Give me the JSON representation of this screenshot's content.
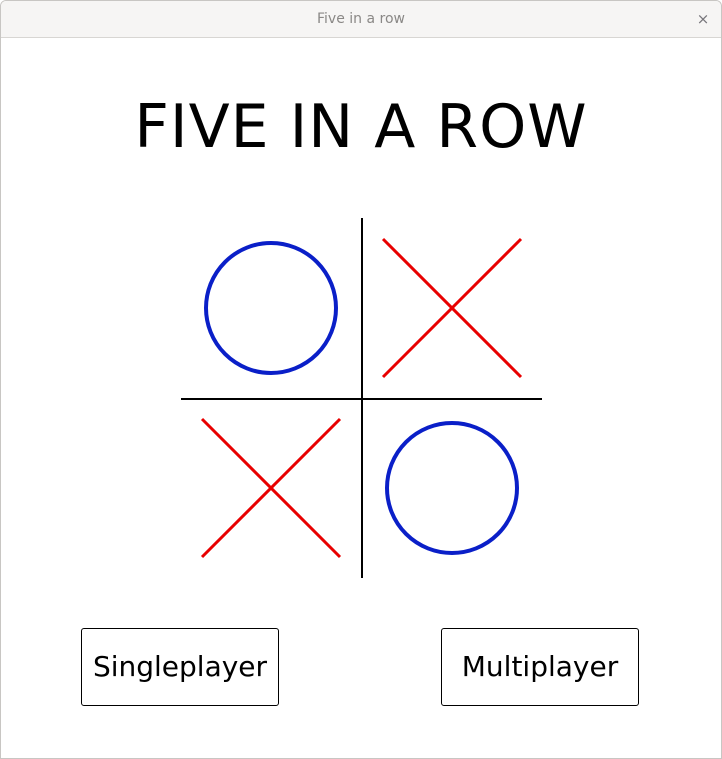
{
  "window": {
    "title": "Five in a row",
    "close_glyph": "×"
  },
  "heading": "FIVE IN A ROW",
  "board": {
    "cells": [
      {
        "mark": "O",
        "color": "#0a1fc8"
      },
      {
        "mark": "X",
        "color": "#e80000"
      },
      {
        "mark": "X",
        "color": "#e80000"
      },
      {
        "mark": "O",
        "color": "#0a1fc8"
      }
    ],
    "grid_color": "#000000"
  },
  "buttons": {
    "singleplayer": "Singleplayer",
    "multiplayer": "Multiplayer"
  }
}
